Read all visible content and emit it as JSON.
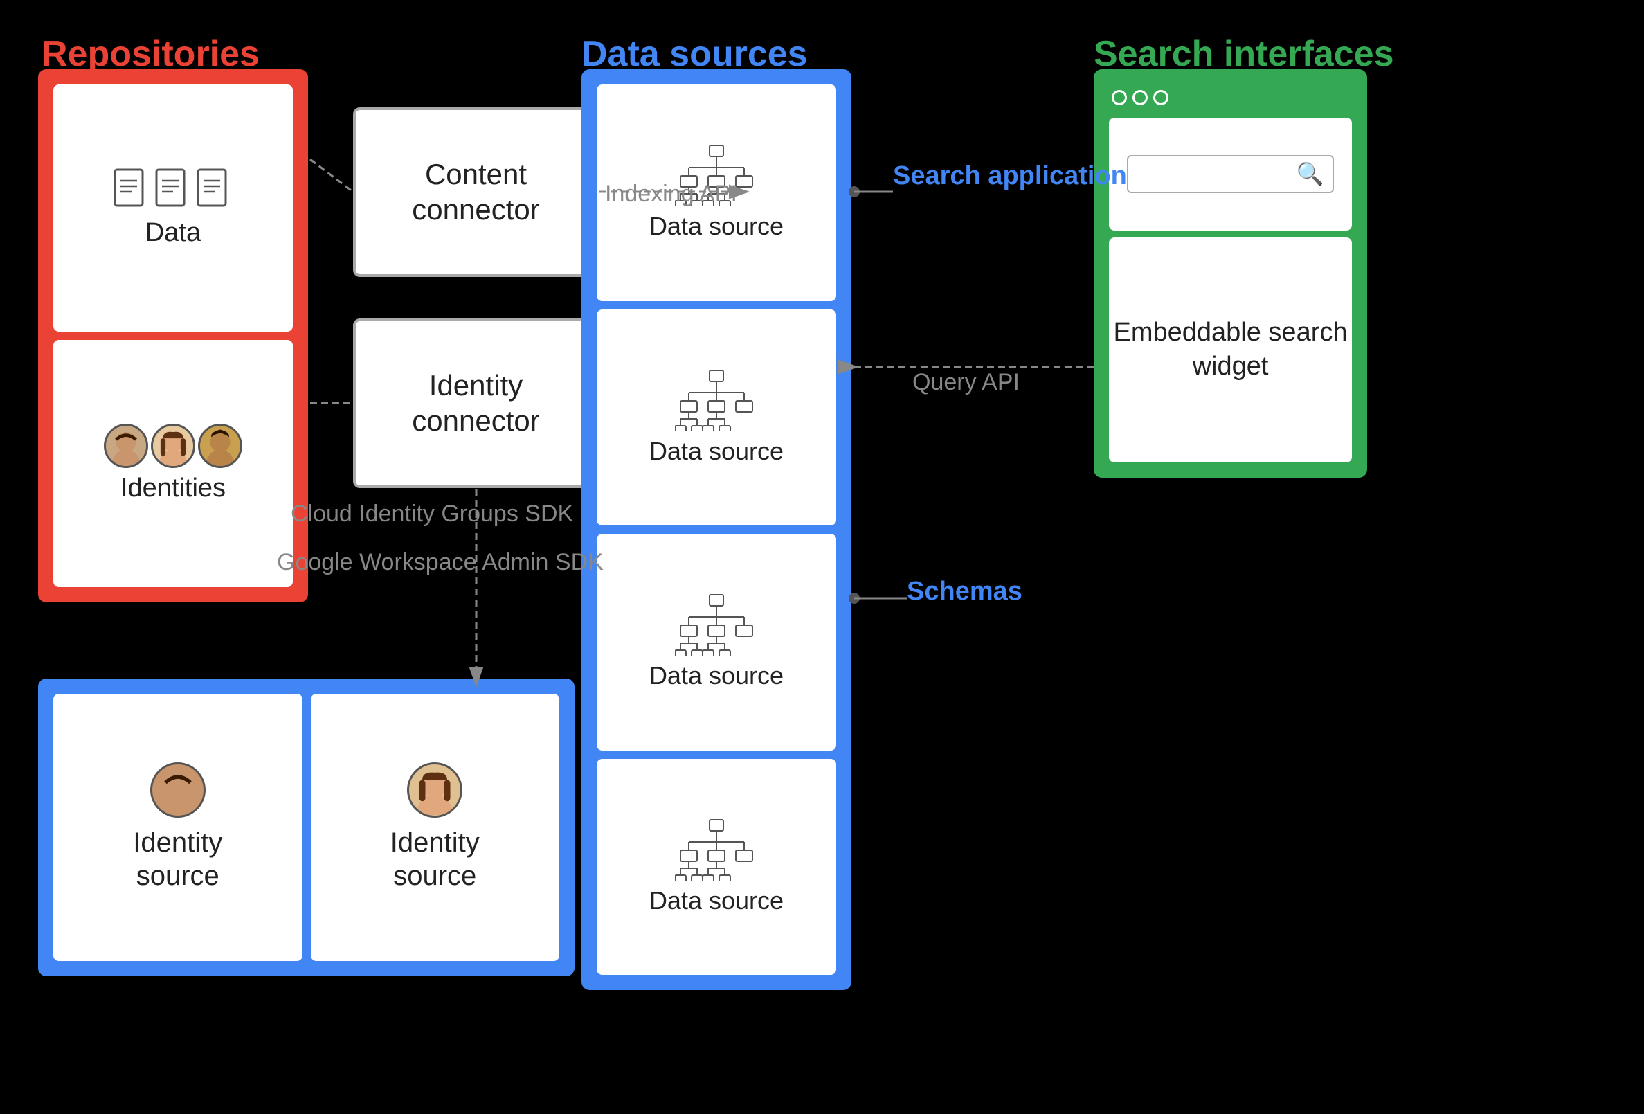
{
  "labels": {
    "repositories": "Repositories",
    "data_sources": "Data sources",
    "search_interfaces": "Search interfaces"
  },
  "repositories": {
    "data_box_label": "Data",
    "identities_box_label": "Identities"
  },
  "connectors": {
    "content_connector": "Content\nconnector",
    "identity_connector": "Identity\nconnector"
  },
  "data_sources": {
    "items": [
      {
        "label": "Data source"
      },
      {
        "label": "Data source"
      },
      {
        "label": "Data source"
      },
      {
        "label": "Data source"
      }
    ]
  },
  "identity_sources": {
    "items": [
      {
        "label": "Identity\nsource"
      },
      {
        "label": "Identity\nsource"
      }
    ]
  },
  "search_interfaces": {
    "search_label": "Search",
    "embeddable_label": "Embeddable\nsearch\nwidget"
  },
  "api_labels": {
    "indexing_api": "Indexing API",
    "query_api": "Query\nAPI",
    "cloud_identity": "Cloud Identity\nGroups SDK",
    "google_workspace": "Google Workspace\nAdmin SDK"
  },
  "blue_labels": {
    "search_application": "Search\napplication",
    "schemas": "Schemas"
  },
  "icons": {
    "search_magnifier": "🔍",
    "face1": "🧑",
    "face2": "👩",
    "face3": "🧑‍🦱"
  }
}
